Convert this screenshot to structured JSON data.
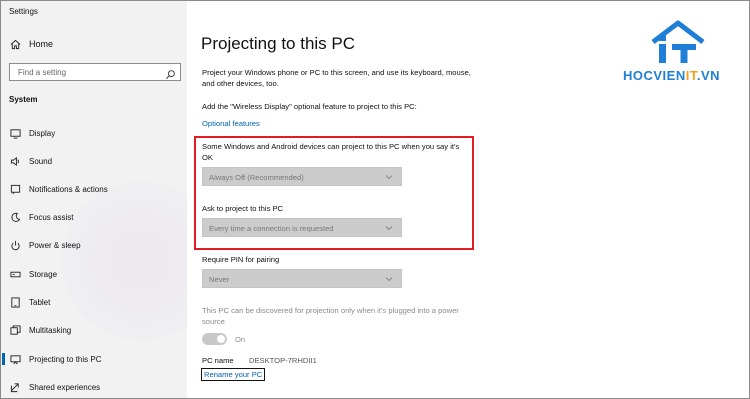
{
  "window": {
    "title": "Settings"
  },
  "sidebar": {
    "home_label": "Home",
    "search_placeholder": "Find a setting",
    "section_label": "System",
    "items": [
      {
        "label": "Display",
        "icon": "monitor-icon"
      },
      {
        "label": "Sound",
        "icon": "speaker-icon"
      },
      {
        "label": "Notifications & actions",
        "icon": "notification-icon"
      },
      {
        "label": "Focus assist",
        "icon": "moon-icon"
      },
      {
        "label": "Power & sleep",
        "icon": "power-icon"
      },
      {
        "label": "Storage",
        "icon": "storage-icon"
      },
      {
        "label": "Tablet",
        "icon": "tablet-icon"
      },
      {
        "label": "Multitasking",
        "icon": "multitasking-icon"
      },
      {
        "label": "Projecting to this PC",
        "icon": "projecting-icon",
        "active": true
      },
      {
        "label": "Shared experiences",
        "icon": "shared-icon"
      }
    ]
  },
  "main": {
    "title": "Projecting to this PC",
    "description": "Project your Windows phone or PC to this screen, and use its keyboard, mouse, and other devices, too.",
    "add_feature_text": "Add the \"Wireless Display\" optional feature to project to this PC:",
    "optional_features_link": "Optional features",
    "setting1": {
      "label": "Some Windows and Android devices can project to this PC when you say it's OK",
      "value": "Always Off (Recommended)"
    },
    "setting2": {
      "label": "Ask to project to this PC",
      "value": "Every time a connection is requested"
    },
    "setting3": {
      "label": "Require PIN for pairing",
      "value": "Never"
    },
    "power_note": "This PC can be discovered for projection only when it's plugged into a power source",
    "toggle_label": "On",
    "toggle_state": "on",
    "pc_name_label": "PC name",
    "pc_name_value": "DESKTOP-7RHDII1",
    "rename_link": "Rename your PC"
  },
  "logo": {
    "text_primary": "HOCVIEN",
    "text_accent": "IT",
    "text_suffix": ".VN",
    "brand_blue": "#1f7fd6",
    "brand_orange": "#f5a11c"
  },
  "colors": {
    "accent": "#0063b1",
    "highlight_border": "#e31b23"
  }
}
